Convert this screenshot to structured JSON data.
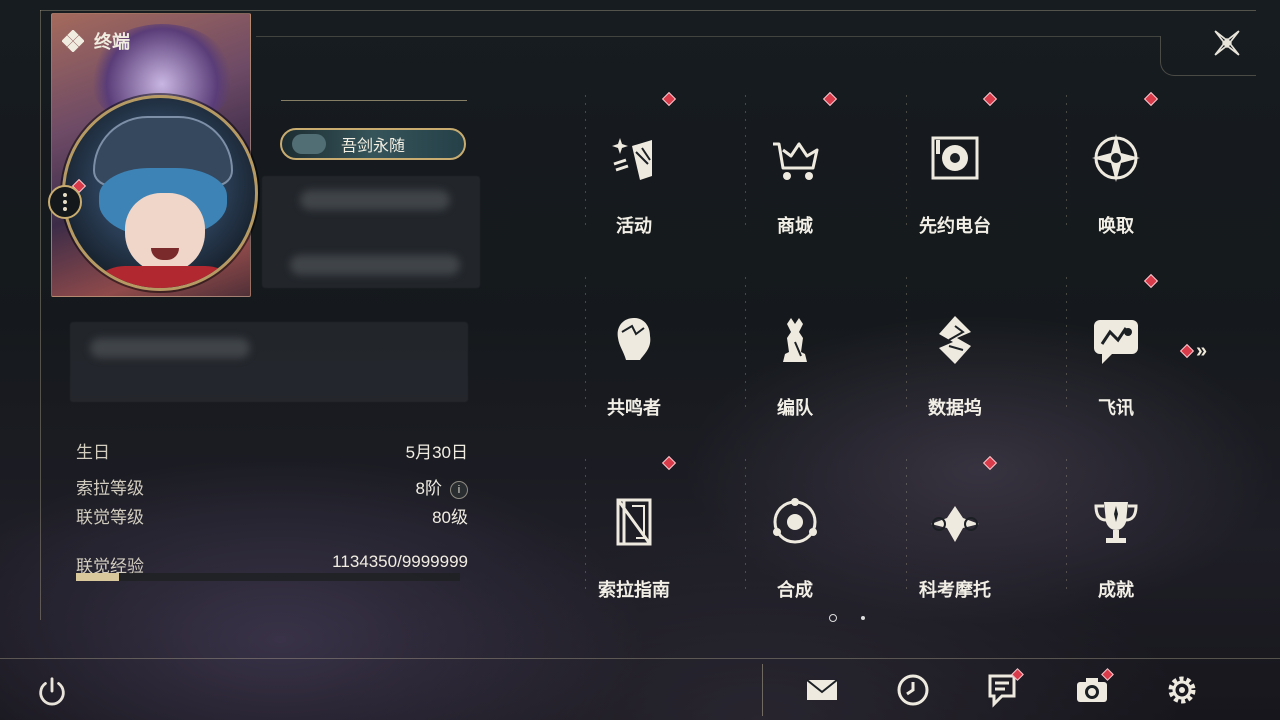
{
  "header": {
    "title": "终端",
    "title_icon": "diamond-cluster-icon",
    "close_icon": "close-x-icon"
  },
  "profile": {
    "title_badge": "吾剑永随",
    "avatar_icon": "character-avatar",
    "menu_icon": "vertical-dots-icon",
    "rows": [
      {
        "label": "生日",
        "value": "5月30日"
      },
      {
        "label": "索拉等级",
        "value": "8阶"
      },
      {
        "label": "联觉等级",
        "value": "80级"
      },
      {
        "label": "联觉经验",
        "value": "1134350/9999999"
      }
    ],
    "exp_progress": 0.113
  },
  "menu": {
    "items": [
      {
        "label": "活动",
        "icon": "sparkle-banner-icon",
        "badge": true
      },
      {
        "label": "商城",
        "icon": "crown-cart-icon",
        "badge": true
      },
      {
        "label": "先约电台",
        "icon": "radio-disc-icon",
        "badge": true
      },
      {
        "label": "唤取",
        "icon": "compass-star-icon",
        "badge": true
      },
      {
        "label": "共鸣者",
        "icon": "character-head-icon",
        "badge": false
      },
      {
        "label": "编队",
        "icon": "chess-pieces-icon",
        "badge": false
      },
      {
        "label": "数据坞",
        "icon": "data-dock-icon",
        "badge": false
      },
      {
        "label": "飞讯",
        "icon": "chat-bubble-icon",
        "badge": true
      },
      {
        "label": "索拉指南",
        "icon": "guide-book-icon",
        "badge": true
      },
      {
        "label": "合成",
        "icon": "synthesis-orbit-icon",
        "badge": false
      },
      {
        "label": "科考摩托",
        "icon": "motorcycle-icon",
        "badge": true
      },
      {
        "label": "成就",
        "icon": "trophy-icon",
        "badge": false
      }
    ],
    "next_page_icon": "double-chevron-right-icon",
    "pages": 2,
    "current_page": 1
  },
  "bottom_bar": {
    "power_icon": "power-icon",
    "buttons": [
      {
        "icon": "mail-icon",
        "badge": false
      },
      {
        "icon": "clock-icon",
        "badge": false
      },
      {
        "icon": "notes-icon",
        "badge": true
      },
      {
        "icon": "camera-icon",
        "badge": true
      },
      {
        "icon": "settings-gear-icon",
        "badge": false
      }
    ]
  },
  "colors": {
    "accent_gold": "#c8ac70",
    "badge_red": "#d93b4a",
    "text": "#f2efe6"
  }
}
